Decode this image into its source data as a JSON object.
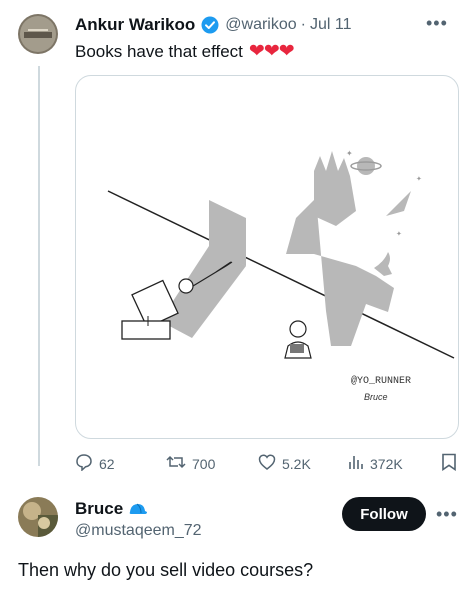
{
  "tweet": {
    "author_name": "Ankur Warikoo",
    "handle": "@warikoo",
    "separator": "·",
    "date": "Jul 11",
    "text": "Books have that effect",
    "hearts": "❤❤❤",
    "image": {
      "signature": "@YO_RUNNER",
      "signature_sub": "Bruce"
    },
    "actions": {
      "replies": "62",
      "reposts": "700",
      "likes": "5.2K",
      "views": "372K"
    },
    "more_icon": "more-icon"
  },
  "reply": {
    "author_name": "Bruce",
    "handle": "@mustaqeem_72",
    "follow_label": "Follow",
    "text": "Then why do you sell video courses?"
  },
  "colors": {
    "verified": "#1d9bf0",
    "heart": "#e8263e",
    "text": "#0f1419",
    "muted": "#536471",
    "shadow": "#b8b8b8"
  }
}
